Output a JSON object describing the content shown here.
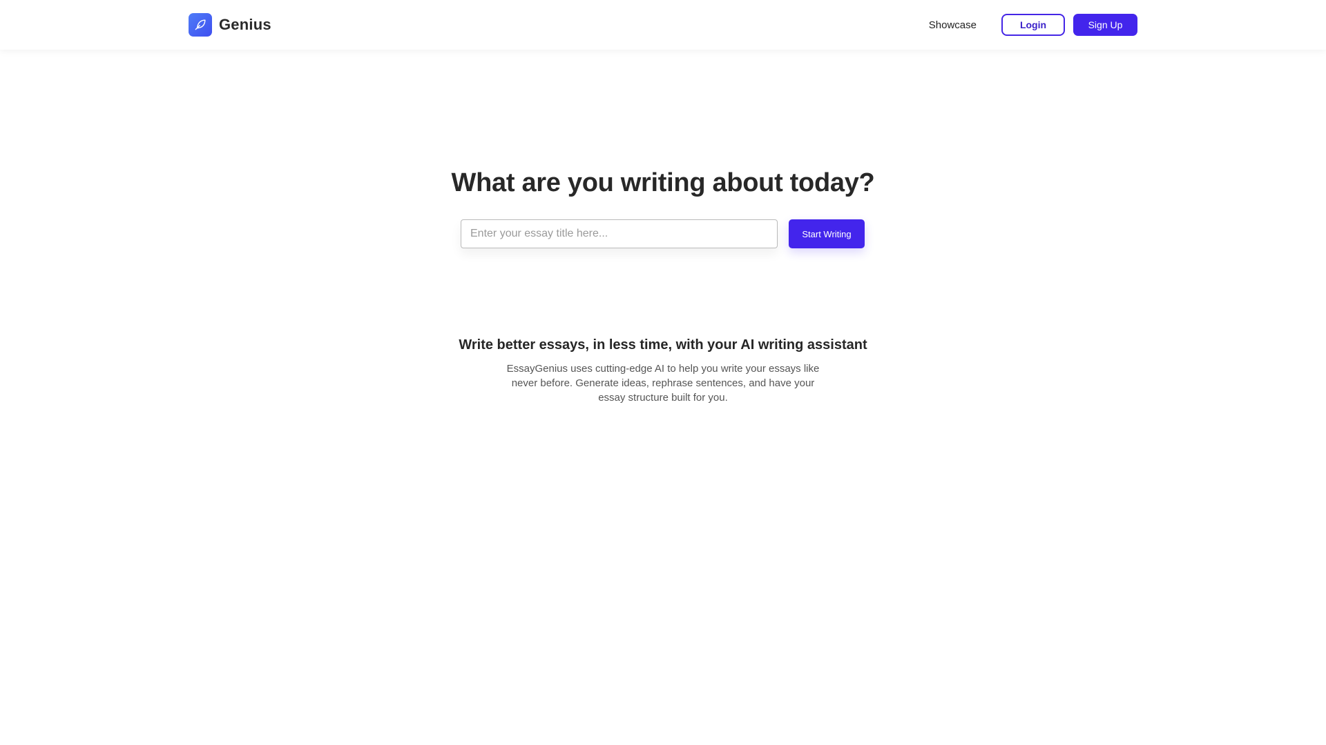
{
  "brand": {
    "name": "Genius",
    "icon": "feather-icon",
    "accent_color": "#4325ec"
  },
  "nav": {
    "showcase_label": "Showcase",
    "login_label": "Login",
    "signup_label": "Sign Up"
  },
  "hero": {
    "title": "What are you writing about today?",
    "input_placeholder": "Enter your essay title here...",
    "input_value": "",
    "start_button_label": "Start Writing"
  },
  "info": {
    "heading": "Write better essays, in less time, with your AI writing assistant",
    "description": "EssayGenius uses cutting-edge AI to help you write your essays like never before. Generate ideas, rephrase sentences, and have your essay structure built for you."
  }
}
